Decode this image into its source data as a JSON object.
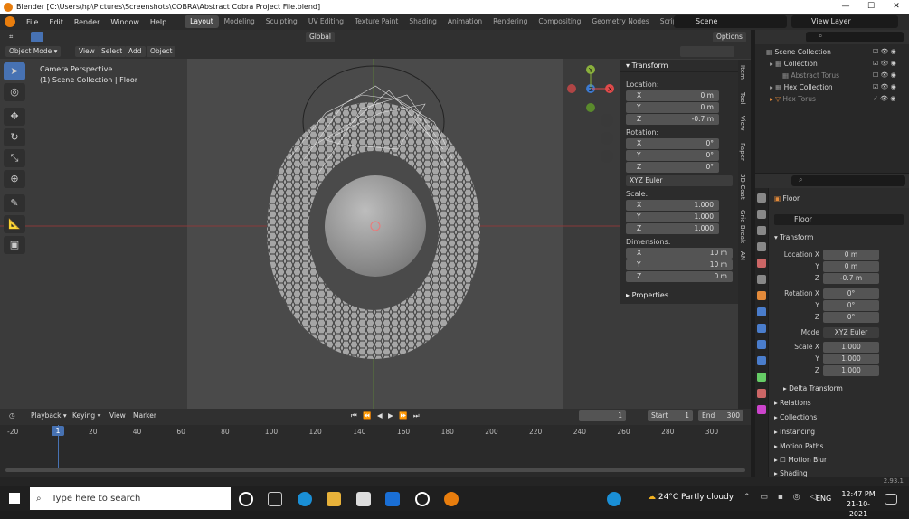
{
  "titlebar": {
    "title": "Blender [C:\\Users\\hp\\Pictures\\Screenshots\\COBRA\\Abstract Cobra Project File.blend]",
    "min": "—",
    "max": "☐",
    "close": "✕"
  },
  "menu": {
    "items": [
      "File",
      "Edit",
      "Render",
      "Window",
      "Help"
    ],
    "workspaces": [
      "Layout",
      "Modeling",
      "Sculpting",
      "UV Editing",
      "Texture Paint",
      "Shading",
      "Animation",
      "Rendering",
      "Compositing",
      "Geometry Nodes",
      "Scripting"
    ],
    "plus": "+",
    "scene": "Scene",
    "view_layer": "View Layer"
  },
  "viewport": {
    "mode": "Object Mode",
    "view": "View",
    "select": "Select",
    "add": "Add",
    "object": "Object",
    "orientation": "Global",
    "options": "Options",
    "overlay_line1": "Camera Perspective",
    "overlay_line2": "(1) Scene Collection | Floor",
    "gizmo": {
      "y": "Y",
      "x": "X",
      "z": "Z"
    }
  },
  "npanel": {
    "title": "Transform",
    "location_label": "Location:",
    "rotation_label": "Rotation:",
    "scale_label": "Scale:",
    "dimensions_label": "Dimensions:",
    "loc": [
      {
        "k": "X",
        "v": "0 m"
      },
      {
        "k": "Y",
        "v": "0 m"
      },
      {
        "k": "Z",
        "v": "-0.7 m"
      }
    ],
    "rot": [
      {
        "k": "X",
        "v": "0°"
      },
      {
        "k": "Y",
        "v": "0°"
      },
      {
        "k": "Z",
        "v": "0°"
      }
    ],
    "rotmode": "XYZ Euler",
    "scale": [
      {
        "k": "X",
        "v": "1.000"
      },
      {
        "k": "Y",
        "v": "1.000"
      },
      {
        "k": "Z",
        "v": "1.000"
      }
    ],
    "dims": [
      {
        "k": "X",
        "v": "10 m"
      },
      {
        "k": "Y",
        "v": "10 m"
      },
      {
        "k": "Z",
        "v": "0 m"
      }
    ],
    "properties": "Properties",
    "tabs": [
      "Item",
      "Tool",
      "View",
      "Paper",
      "3D-Coat",
      "Grid Break",
      "AN"
    ]
  },
  "timeline": {
    "playback": "Playback",
    "keying": "Keying",
    "view": "View",
    "marker": "Marker",
    "frame": "1",
    "start_label": "Start",
    "start": "1",
    "end_label": "End",
    "end": "300",
    "ticks": [
      "-20",
      "20",
      "40",
      "60",
      "80",
      "100",
      "120",
      "140",
      "160",
      "180",
      "200",
      "220",
      "240",
      "260",
      "280",
      "300"
    ],
    "current": "1"
  },
  "outliner": {
    "rows": [
      {
        "label": "Scene Collection",
        "color": "#dddddd"
      },
      {
        "label": "Collection",
        "color": "#dddddd"
      },
      {
        "label": "Abstract Torus",
        "color": "#888888"
      },
      {
        "label": "Hex Collection",
        "color": "#dddddd"
      },
      {
        "label": "Hex Torus",
        "color": "#888888"
      }
    ]
  },
  "properties": {
    "object_name": "Floor",
    "data_name": "Floor",
    "transform": "Transform",
    "location_x_label": "Location X",
    "y_label": "Y",
    "z_label": "Z",
    "rotation_x_label": "Rotation X",
    "scale_x_label": "Scale X",
    "loc": [
      "0 m",
      "0 m",
      "-0.7 m"
    ],
    "rot": [
      "0°",
      "0°",
      "0°"
    ],
    "mode_label": "Mode",
    "mode": "XYZ Euler",
    "scale": [
      "1.000",
      "1.000",
      "1.000"
    ],
    "sections": [
      "Delta Transform",
      "Relations",
      "Collections",
      "Instancing",
      "Motion Paths",
      "Motion Blur",
      "Shading"
    ]
  },
  "status": {
    "version": "2.93.1"
  },
  "taskbar": {
    "search_placeholder": "Type here to search",
    "weather": "24°C  Partly cloudy",
    "lang": "ENG",
    "time": "12:47 PM",
    "date": "21-10-2021"
  }
}
